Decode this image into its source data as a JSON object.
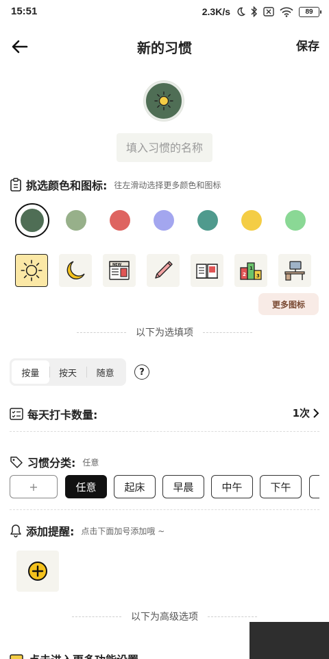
{
  "status_bar": {
    "time": "15:51",
    "network_speed": "2.3K/s",
    "battery": "89",
    "icons": [
      "moon-icon",
      "bluetooth-icon",
      "sim-x-icon",
      "wifi-icon",
      "battery-icon"
    ]
  },
  "header": {
    "back_icon": "back-arrow-icon",
    "title": "新的习惯",
    "save_label": "保存"
  },
  "habit": {
    "icon": "sun-icon",
    "icon_bg_color": "#4f6e55",
    "name_placeholder": "填入习惯的名称",
    "name_value": ""
  },
  "appearance": {
    "title": "挑选颜色和图标:",
    "hint": "往左滑动选择更多颜色和图标",
    "colors": [
      "#4f6e55",
      "#97b08a",
      "#de6460",
      "#a3a6ef",
      "#4f9a8d",
      "#f4cd45",
      "#8ad895"
    ],
    "selected_color_index": 0,
    "icons": [
      "sun-icon",
      "moon-icon",
      "newspaper-icon",
      "pencil-icon",
      "open-book-icon",
      "podium-icon",
      "desk-computer-icon"
    ],
    "selected_icon_index": 0,
    "more_icons_label": "更多图标"
  },
  "optional_divider": "以下为选填项",
  "mode_toggle": {
    "options": [
      "按量",
      "按天",
      "随意"
    ],
    "selected_index": 0,
    "help_symbol": "?"
  },
  "daily_count": {
    "title": "每天打卡数量:",
    "value": "1次"
  },
  "category": {
    "title": "习惯分类:",
    "current": "任意",
    "chips": [
      "+",
      "任意",
      "起床",
      "早晨",
      "中午",
      "下午"
    ],
    "selected_index": 1
  },
  "reminder": {
    "title": "添加提醒:",
    "hint": "点击下面加号添加哦 ~"
  },
  "advanced_divider": "以下为高级选项",
  "bottom_row": {
    "text": "点击进入更多功能设置"
  }
}
